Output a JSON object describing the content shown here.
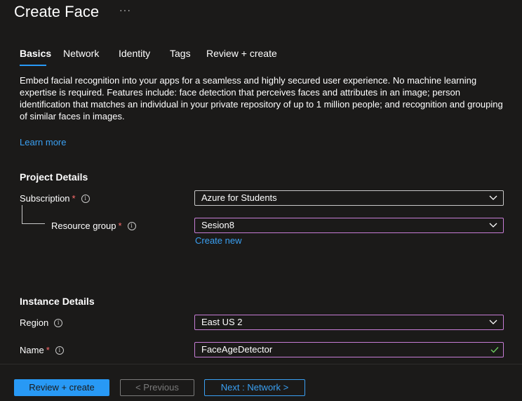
{
  "header": {
    "title": "Create Face",
    "more": "···"
  },
  "tabs": [
    {
      "label": "Basics"
    },
    {
      "label": "Network"
    },
    {
      "label": "Identity"
    },
    {
      "label": "Tags"
    },
    {
      "label": "Review + create"
    }
  ],
  "description": "Embed facial recognition into your apps for a seamless and highly secured user experience. No machine learning expertise is required. Features include: face detection that perceives faces and attributes in an image; person identification that matches an individual in your private repository of up to 1 million people; and recognition and grouping of similar faces in images.",
  "learn_more": "Learn more",
  "project_details": {
    "heading": "Project Details",
    "subscription": {
      "label": "Subscription",
      "required": "*",
      "value": "Azure for Students",
      "icon": "chevron-down-icon"
    },
    "resource_group": {
      "label": "Resource group",
      "required": "*",
      "value": "Sesion8",
      "create_new": "Create new",
      "icon": "chevron-down-icon"
    }
  },
  "instance_details": {
    "heading": "Instance Details",
    "region": {
      "label": "Region",
      "value": "East US 2",
      "icon": "chevron-down-icon"
    },
    "name": {
      "label": "Name",
      "required": "*",
      "value": "FaceAgeDetector",
      "icon": "checkmark-icon"
    }
  },
  "footer": {
    "review_create": "Review + create",
    "previous": "< Previous",
    "next": "Next : Network >"
  },
  "colors": {
    "accent": "#2899f5",
    "link": "#3aa0f3",
    "required": "#ff6d6d",
    "focus_border": "#c77dd6",
    "valid_check": "#6ccb5f",
    "background": "#1b1a19"
  },
  "info_icon_glyph": "i"
}
